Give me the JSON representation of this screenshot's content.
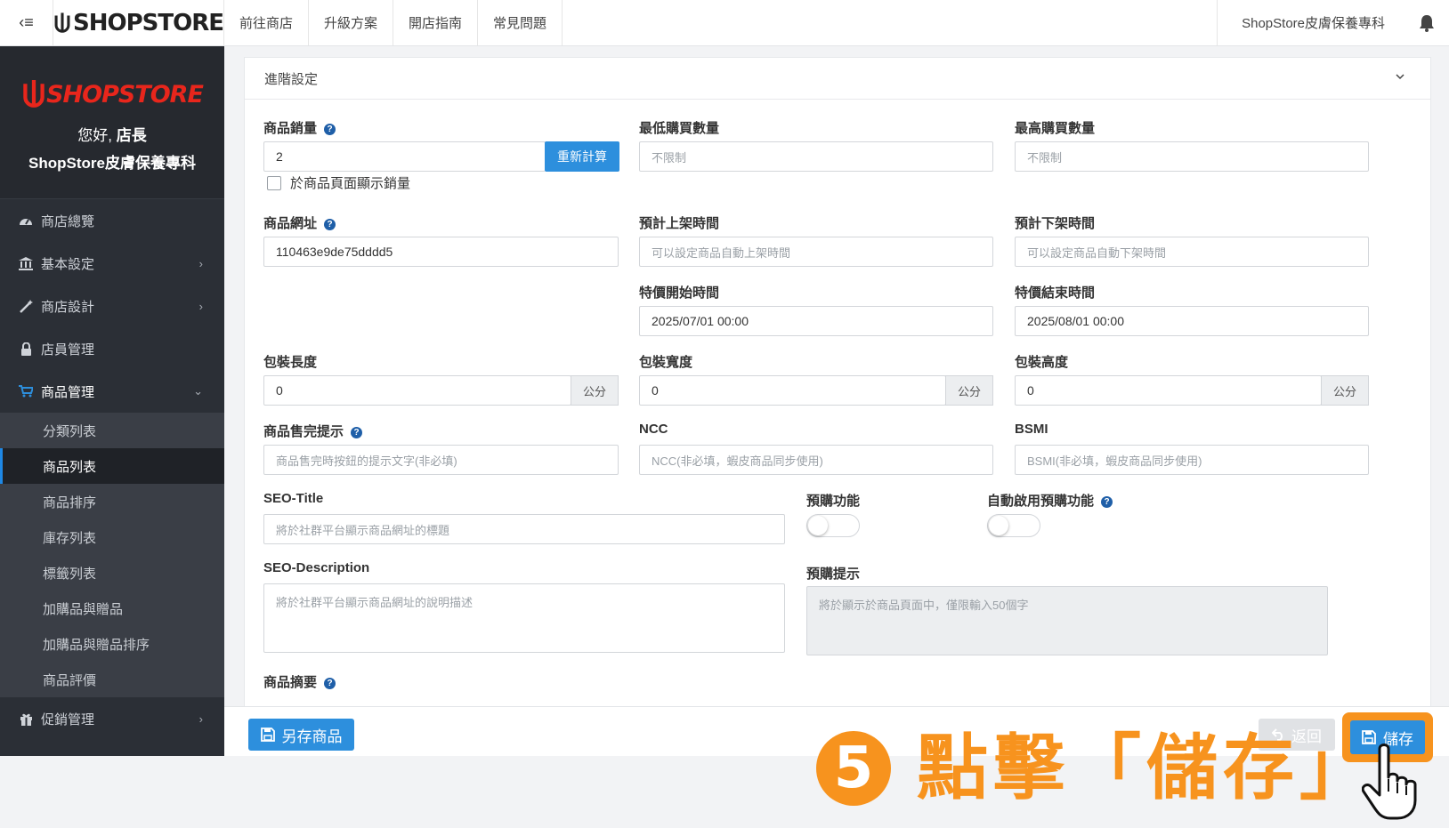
{
  "topbar": {
    "toggle_icon": "back-menu-icon",
    "logo_text": "SHOPSTORE",
    "nav": [
      "前往商店",
      "升級方案",
      "開店指南",
      "常見問題"
    ],
    "store_name": "ShopStore皮膚保養專科"
  },
  "sidebar": {
    "logo_text": "SHOPSTORE",
    "greeting_prefix": "您好,",
    "greeting_role": "店長",
    "store_name": "ShopStore皮膚保養專科",
    "menu": [
      {
        "label": "商店總覽",
        "icon": "dashboard-icon"
      },
      {
        "label": "基本設定",
        "icon": "bank-icon"
      },
      {
        "label": "商店設計",
        "icon": "magic-wand-icon"
      },
      {
        "label": "店員管理",
        "icon": "lock-icon"
      },
      {
        "label": "商品管理",
        "icon": "cart-icon"
      }
    ],
    "submenu": [
      "分類列表",
      "商品列表",
      "商品排序",
      "庫存列表",
      "標籤列表",
      "加購品與贈品",
      "加購品與贈品排序",
      "商品評價"
    ],
    "menu_after": {
      "label": "促銷管理",
      "icon": "gift-icon"
    },
    "active_submenu": "商品列表"
  },
  "panel": {
    "title": "進階設定",
    "sales": {
      "label": "商品銷量",
      "value": "2",
      "button": "重新計算",
      "checkbox": "於商品頁面顯示銷量"
    },
    "min_qty": {
      "label": "最低購買數量",
      "placeholder": "不限制"
    },
    "max_qty": {
      "label": "最高購買數量",
      "placeholder": "不限制"
    },
    "url": {
      "label": "商品網址",
      "value": "110463e9de75dddd5"
    },
    "on_shelf": {
      "label": "預計上架時間",
      "placeholder": "可以設定商品自動上架時間"
    },
    "off_shelf": {
      "label": "預計下架時間",
      "placeholder": "可以設定商品自動下架時間"
    },
    "special_start": {
      "label": "特價開始時間",
      "value": "2025/07/01 00:00"
    },
    "special_end": {
      "label": "特價結束時間",
      "value": "2025/08/01 00:00"
    },
    "pkg_length": {
      "label": "包裝長度",
      "value": "0",
      "unit": "公分"
    },
    "pkg_width": {
      "label": "包裝寬度",
      "value": "0",
      "unit": "公分"
    },
    "pkg_height": {
      "label": "包裝高度",
      "value": "0",
      "unit": "公分"
    },
    "soldout": {
      "label": "商品售完提示",
      "placeholder": "商品售完時按鈕的提示文字(非必填)"
    },
    "ncc": {
      "label": "NCC",
      "placeholder": "NCC(非必填，蝦皮商品同步使用)"
    },
    "bsmi": {
      "label": "BSMI",
      "placeholder": "BSMI(非必填，蝦皮商品同步使用)"
    },
    "seo_title": {
      "label": "SEO-Title",
      "placeholder": "將於社群平台顯示商品網址的標題"
    },
    "preorder": {
      "label": "預購功能",
      "enabled": false
    },
    "auto_preorder": {
      "label": "自動啟用預購功能",
      "enabled": false
    },
    "seo_desc": {
      "label": "SEO-Description",
      "placeholder": "將於社群平台顯示商品網址的說明描述"
    },
    "preorder_hint": {
      "label": "預購提示",
      "placeholder": "將於顯示於商品頁面中，僅限輸入50個字"
    },
    "summary": {
      "label": "商品摘要"
    }
  },
  "footer": {
    "save_as": "另存商品",
    "back": "返回",
    "save": "儲存"
  },
  "annotation": {
    "step": "5",
    "text": "點擊「儲存」",
    "color": "#f7931e"
  },
  "colors": {
    "primary": "#2d8fdd",
    "sidebar_bg": "#2b2f36",
    "brand_red": "#e8261c"
  }
}
